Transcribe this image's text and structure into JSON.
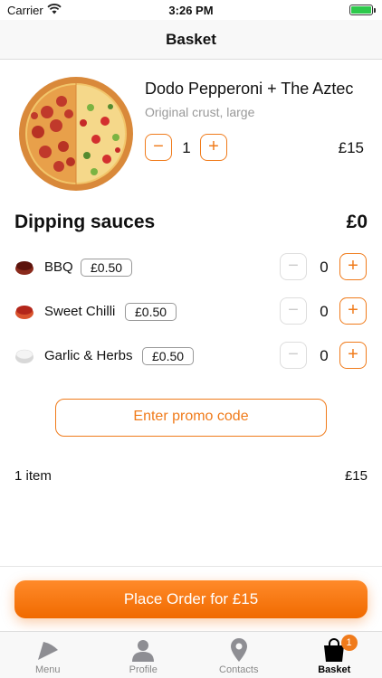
{
  "status_bar": {
    "carrier": "Carrier",
    "time": "3:26 PM"
  },
  "nav": {
    "title": "Basket"
  },
  "item": {
    "name": "Dodo Pepperoni + The Aztec",
    "description": "Original crust, large",
    "quantity": "1",
    "price": "£15",
    "decrement_label": "−",
    "increment_label": "+"
  },
  "sauces": {
    "title": "Dipping sauces",
    "total": "£0",
    "items": [
      {
        "name": "BBQ",
        "price": "£0.50",
        "quantity": "0",
        "icon": "bbq-sauce-icon"
      },
      {
        "name": "Sweet Chilli",
        "price": "£0.50",
        "quantity": "0",
        "icon": "sweet-chilli-sauce-icon"
      },
      {
        "name": "Garlic & Herbs",
        "price": "£0.50",
        "quantity": "0",
        "icon": "garlic-herbs-sauce-icon"
      }
    ],
    "decrement_label": "−",
    "increment_label": "+"
  },
  "promo": {
    "label": "Enter promo code"
  },
  "summary": {
    "count": "1 item",
    "price": "£15"
  },
  "order_button": {
    "label": "Place Order for £15"
  },
  "tabbar": {
    "items": [
      {
        "label": "Menu",
        "icon": "pizza-slice-icon"
      },
      {
        "label": "Profile",
        "icon": "person-icon"
      },
      {
        "label": "Contacts",
        "icon": "map-pin-icon"
      },
      {
        "label": "Basket",
        "icon": "bag-icon",
        "badge": "1"
      }
    ]
  },
  "colors": {
    "accent": "#f07b1b",
    "battery": "#2ec94c"
  }
}
